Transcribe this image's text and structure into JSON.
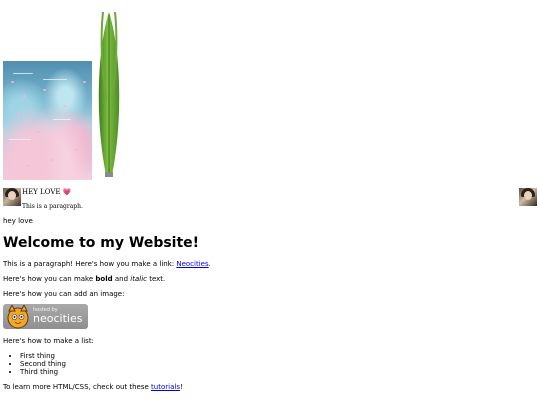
{
  "top": {
    "hey_love": "HEY LOVE",
    "heart": "💗",
    "small_paragraph": "This is a paragraph.",
    "hey_love_lower": "hey love"
  },
  "main": {
    "title": "Welcome to my Website!",
    "link_para_prefix": "This is a paragraph! Here's how you make a link: ",
    "link_text": "Neocities",
    "link_para_suffix": ".",
    "bold_prefix": "Here's how you can make ",
    "bold_word": "bold",
    "bold_mid": " and ",
    "italic_word": "italic",
    "bold_suffix": " text.",
    "image_para": "Here's how you can add an image:",
    "badge": {
      "hosted_by": "hosted by",
      "name": "neocities"
    },
    "list_para": "Here's how to make a list:",
    "list_items": [
      "First thing",
      "Second thing",
      "Third thing"
    ],
    "learn_prefix": "To learn more HTML/CSS, check out these ",
    "learn_link": "tutorials",
    "learn_suffix": "!"
  }
}
